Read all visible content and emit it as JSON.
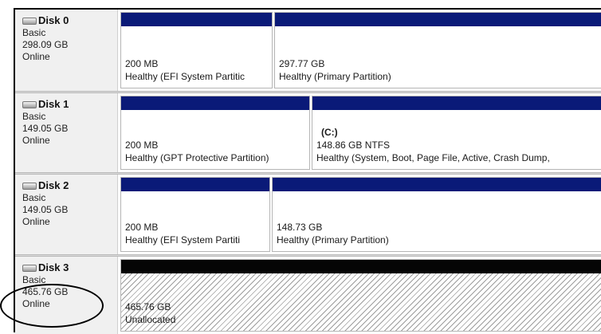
{
  "disks": [
    {
      "name": "Disk 0",
      "type": "Basic",
      "size": "298.09 GB",
      "status": "Online",
      "partitions": [
        {
          "size": "200 MB",
          "status": "Healthy (EFI System Partitic"
        },
        {
          "size": "297.77 GB",
          "status": "Healthy (Primary Partition)"
        }
      ]
    },
    {
      "name": "Disk 1",
      "type": "Basic",
      "size": "149.05 GB",
      "status": "Online",
      "partitions": [
        {
          "size": "200 MB",
          "status": "Healthy (GPT Protective Partition)"
        },
        {
          "volume": "(C:)",
          "size": "148.86 GB NTFS",
          "status": "Healthy (System, Boot, Page File, Active, Crash Dump,"
        }
      ]
    },
    {
      "name": "Disk 2",
      "type": "Basic",
      "size": "149.05 GB",
      "status": "Online",
      "partitions": [
        {
          "size": "200 MB",
          "status": "Healthy (EFI System Partiti"
        },
        {
          "size": "148.73 GB",
          "status": "Healthy (Primary Partition)"
        }
      ]
    },
    {
      "name": "Disk 3",
      "type": "Basic",
      "size": "465.76 GB",
      "status": "Online",
      "partitions": [
        {
          "size": "465.76 GB",
          "status": "Unallocated"
        }
      ]
    }
  ],
  "colors": {
    "primary_bar": "#0a1a78",
    "unallocated_bar": "#050505"
  }
}
